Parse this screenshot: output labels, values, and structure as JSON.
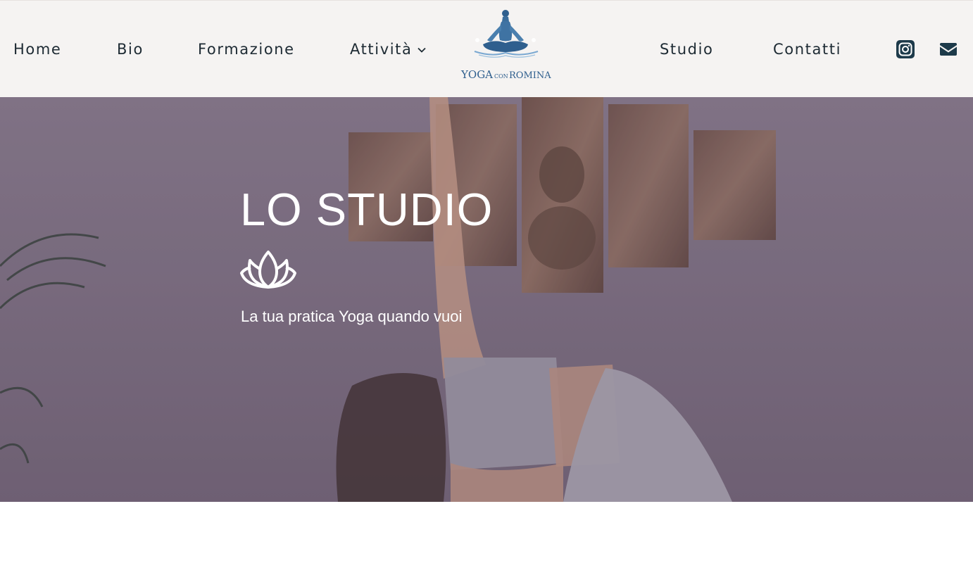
{
  "nav": {
    "items": [
      {
        "label": "Home"
      },
      {
        "label": "Bio"
      },
      {
        "label": "Formazione"
      },
      {
        "label": "Attività"
      },
      {
        "label": "Studio"
      },
      {
        "label": "Contatti"
      }
    ],
    "dropdown_icon": "chevron-down-icon"
  },
  "logo": {
    "text_main": "YOGA",
    "text_small": "CON",
    "text_name": "ROMINA",
    "icon": "meditation-figure-icon"
  },
  "social": {
    "instagram_icon": "instagram-icon",
    "email_icon": "envelope-icon"
  },
  "hero": {
    "title": "LO STUDIO",
    "icon": "lotus-icon",
    "subtitle": "La tua pratica Yoga quando vuoi"
  },
  "colors": {
    "header_bg": "#f5f3f2",
    "nav_text": "#1d2a33",
    "logo_blue": "#2f5f8e",
    "hero_overlay": "#786a7d",
    "hero_text": "#ffffff"
  }
}
